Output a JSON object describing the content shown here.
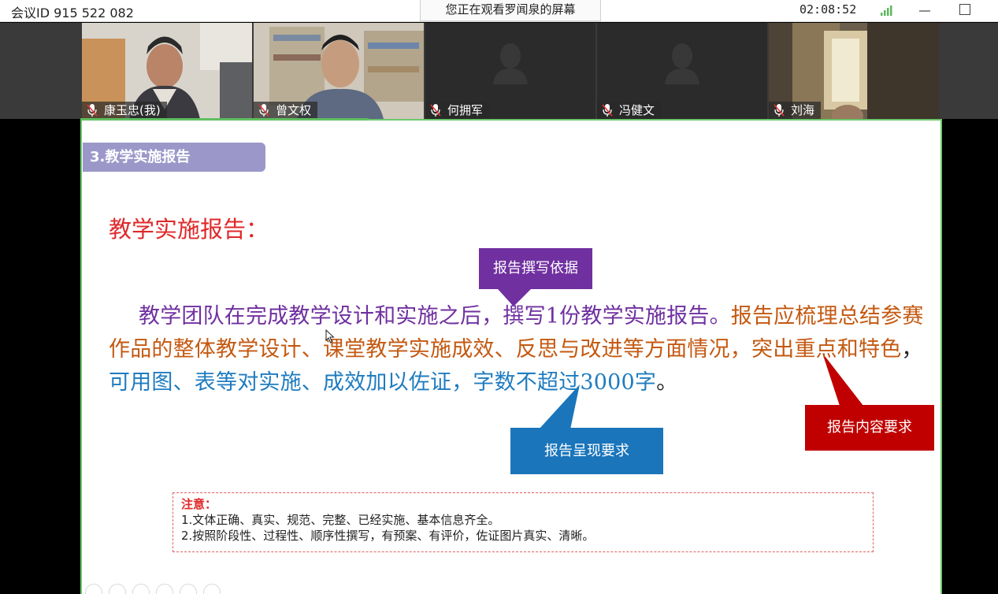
{
  "topbar": {
    "meeting_id": "会议ID 915 522 082",
    "share_banner": "您正在观看罗闻泉的屏幕",
    "timer": "02:08:52",
    "icons": [
      "signal-icon",
      "minimize-icon",
      "maximize-icon"
    ]
  },
  "participants": [
    {
      "name": "康玉忠(我)",
      "video": "on"
    },
    {
      "name": "曾文权",
      "video": "on"
    },
    {
      "name": "何拥军",
      "video": "off"
    },
    {
      "name": "冯健文",
      "video": "off"
    },
    {
      "name": "刘海",
      "video": "on"
    }
  ],
  "slide": {
    "section_tag": "3.教学实施报告",
    "title": "教学实施报告：",
    "body": {
      "part1": "教学团队在完成教学设计和实施之后，撰写1份教学实施报告。",
      "part2": "报告应梳理总结参赛作品的整体教学设计、课堂教学实施成效、反思与改进等方面情况，突出重点和特色",
      "part3": "，",
      "part4": "可用图、表等对实施、成效加以佐证，字数不超过3000字",
      "part5": "。"
    },
    "callouts": {
      "basis": "报告撰写依据",
      "presentation": "报告呈现要求",
      "content": "报告内容要求"
    },
    "note": {
      "title": "注意：",
      "line1": "1.文体正确、真实、规范、完整、已经实施、基本信息齐全。",
      "line2": "2.按照阶段性、过程性、顺序性撰写，有预案、有评价，佐证图片真实、清晰。"
    },
    "colors": {
      "title": "#e0282a",
      "basis": "#7030a0",
      "content": "#c45911",
      "presentation": "#1f7cc0",
      "content_callout": "#c00000",
      "section_tag": "#9b98c9"
    }
  }
}
